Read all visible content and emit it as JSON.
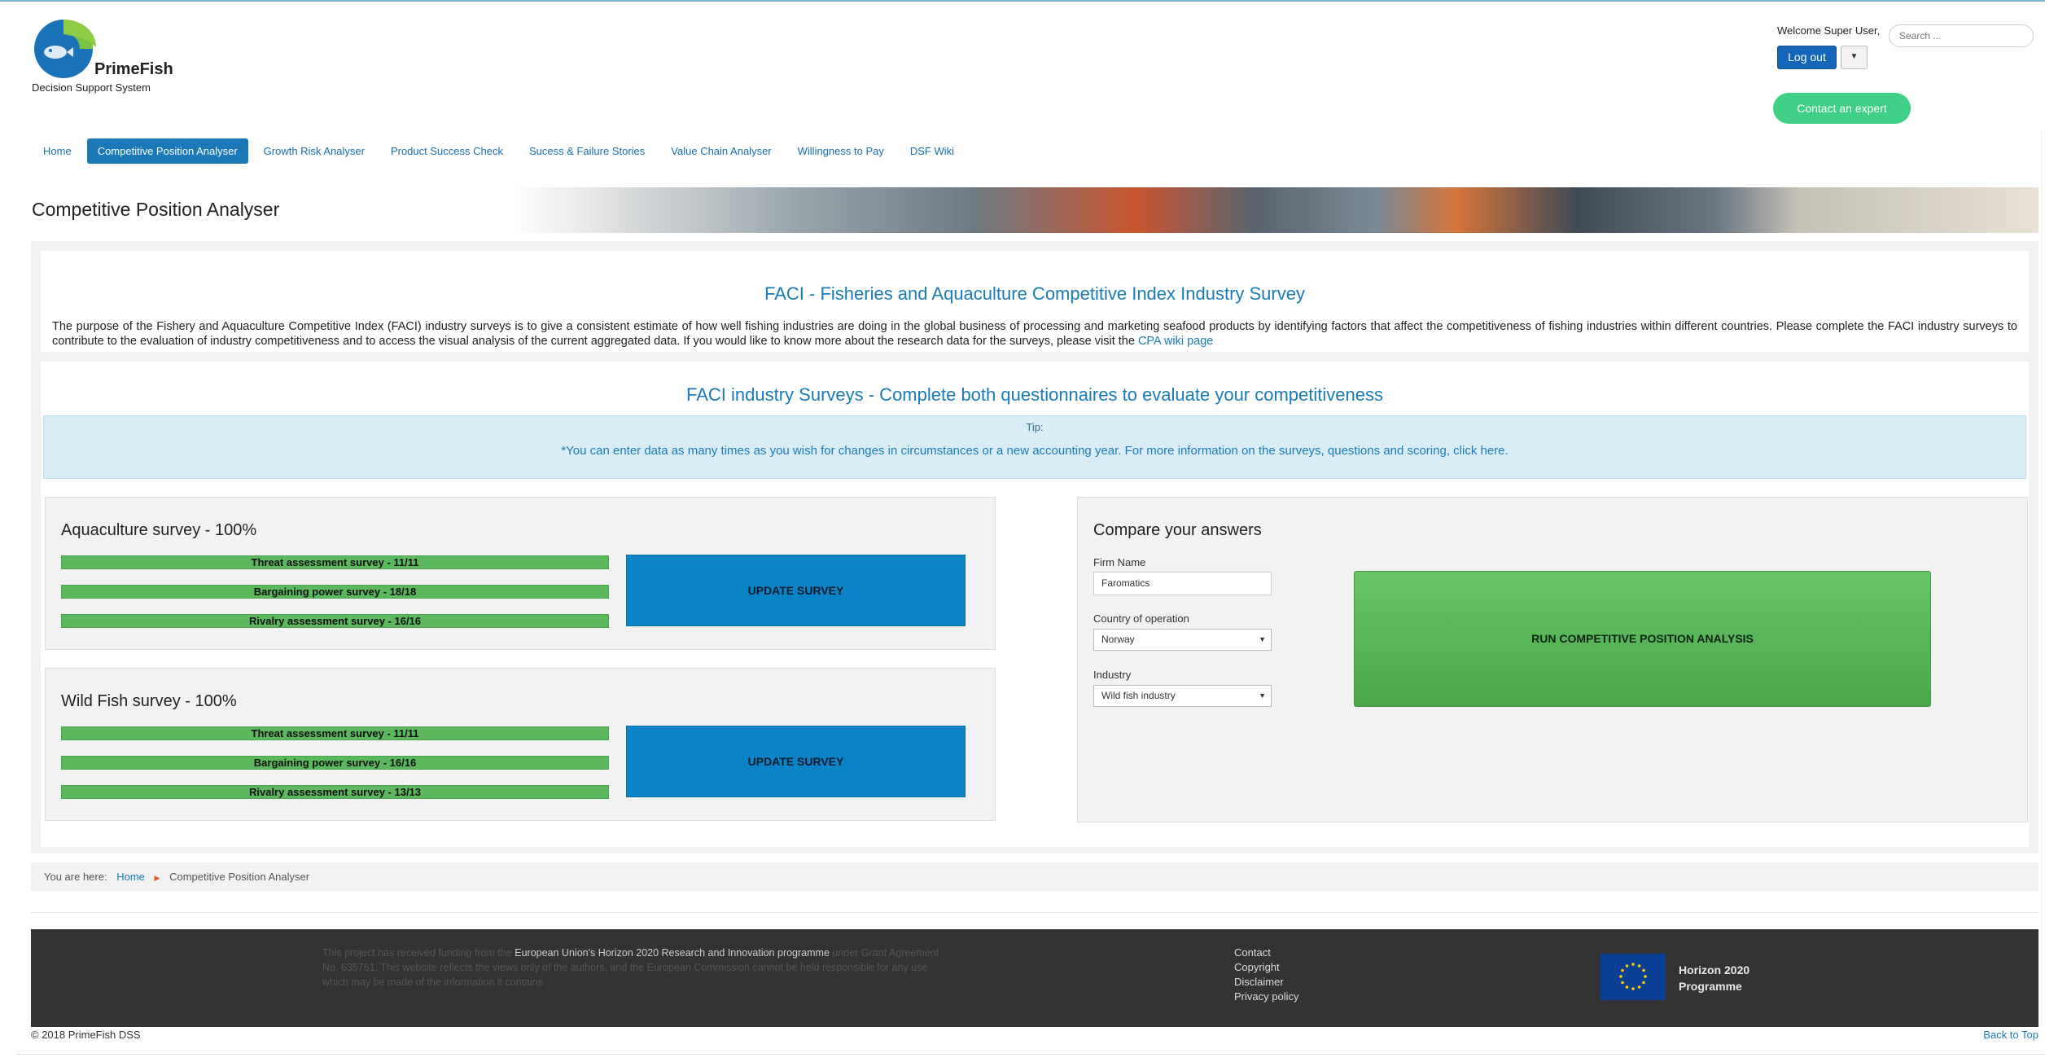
{
  "brand": {
    "name": "PrimeFish",
    "subtitle": "Decision Support System"
  },
  "header": {
    "welcome": "Welcome Super User,",
    "search_placeholder": "Search ...",
    "logout_label": "Log out",
    "contact_label": "Contact an expert"
  },
  "nav": {
    "items": [
      {
        "label": "Home"
      },
      {
        "label": "Competitive Position Analyser",
        "active": true
      },
      {
        "label": "Growth Risk Analyser"
      },
      {
        "label": "Product Success Check"
      },
      {
        "label": "Sucess & Failure Stories"
      },
      {
        "label": "Value Chain Analyser"
      },
      {
        "label": "Willingness to Pay"
      },
      {
        "label": "DSF Wiki"
      }
    ]
  },
  "page": {
    "title": "Competitive Position Analyser"
  },
  "intro": {
    "title": "FACI - Fisheries and Aquaculture Competitive Index Industry Survey",
    "text": "The purpose of the Fishery and Aquaculture Competitive Index (FACI) industry surveys is to give a consistent estimate of how well fishing industries are doing in the global business of processing and marketing seafood products by identifying factors that affect the competitiveness of fishing industries within different countries. Please complete the FACI industry surveys to contribute to the evaluation of industry competitiveness and to access the visual analysis of the current aggregated data. If you would like to know more about the research data for the surveys, please visit the",
    "link_text": "CPA wiki page"
  },
  "surveys": {
    "title": "FACI industry Surveys - Complete both questionnaires to evaluate your competitiveness",
    "tip_label": "Tip:",
    "tip_text": "*You can enter data as many times as you wish for changes in circumstances or a new accounting year. For more information on the surveys, questions and scoring, click here.",
    "update_label": "UPDATE SURVEY",
    "aquaculture": {
      "title": "Aquaculture survey - 100%",
      "bars": [
        {
          "label": "Threat assessment survey - 11/11",
          "progress": 1.0
        },
        {
          "label": "Bargaining power survey - 18/18",
          "progress": 1.0
        },
        {
          "label": "Rivalry assessment survey - 16/16",
          "progress": 1.0
        }
      ]
    },
    "wildfish": {
      "title": "Wild Fish survey - 100%",
      "bars": [
        {
          "label": "Threat assessment survey - 11/11",
          "progress": 1.0
        },
        {
          "label": "Bargaining power survey - 16/16",
          "progress": 1.0
        },
        {
          "label": "Rivalry assessment survey - 13/13",
          "progress": 1.0
        }
      ]
    }
  },
  "compare": {
    "title": "Compare your answers",
    "firm_label": "Firm Name",
    "firm_value": "Faromatics",
    "country_label": "Country of operation",
    "country_value": "Norway",
    "industry_label": "Industry",
    "industry_value": "Wild fish industry",
    "run_label": "RUN COMPETITIVE POSITION ANALYSIS"
  },
  "breadcrumb": {
    "prefix": "You are here:",
    "home": "Home",
    "current": "Competitive Position Analyser"
  },
  "footer": {
    "funding_1": "This project has received funding from the",
    "funding_hl": "European Union's Horizon 2020 Research and Innovation programme",
    "funding_2": "under Grant Agreement No. 635761. This website reflects the views only of the authors, and the European Commission cannot be held responsible for any use which may be made of the information it contains",
    "links": [
      "Contact",
      "Copyright",
      "Disclaimer",
      "Privacy policy"
    ],
    "horizon_1": "Horizon 2020",
    "horizon_2": "Programme",
    "copyright": "© 2018 PrimeFish DSS",
    "back_to_top": "Back to Top"
  },
  "colors": {
    "accent": "#1a7bb9",
    "nav_active": "#1a79b6",
    "contact_green": "#3fcf85",
    "progress_green": "#5cb85c",
    "update_blue": "#0a84c6",
    "footer_bg": "#333333"
  }
}
